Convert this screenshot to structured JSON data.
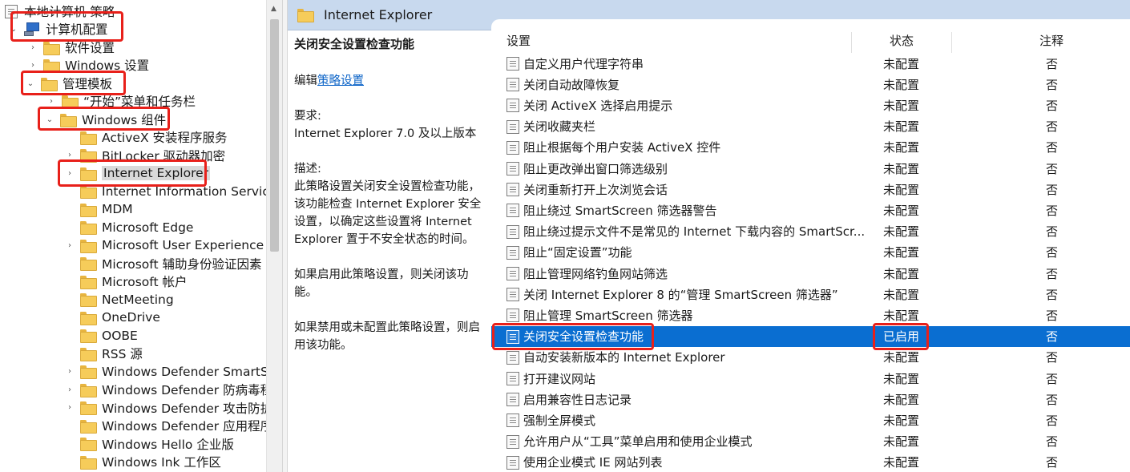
{
  "tree": {
    "root_label": "本地计算机 策略",
    "computer_config": "计算机配置",
    "software_settings": "软件设置",
    "windows_settings": "Windows 设置",
    "admin_templates": "管理模板",
    "start_menu": "“开始”菜单和任务栏",
    "windows_components": "Windows 组件",
    "components": [
      {
        "label": "ActiveX 安装程序服务",
        "expandable": false
      },
      {
        "label": "BitLocker 驱动器加密",
        "expandable": true
      },
      {
        "label": "Internet Explorer",
        "expandable": true,
        "selected": true
      },
      {
        "label": "Internet Information Services",
        "expandable": false
      },
      {
        "label": "MDM",
        "expandable": false
      },
      {
        "label": "Microsoft Edge",
        "expandable": false
      },
      {
        "label": "Microsoft User Experience Virt",
        "expandable": true
      },
      {
        "label": "Microsoft 辅助身份验证因素",
        "expandable": false
      },
      {
        "label": "Microsoft 帐户",
        "expandable": false
      },
      {
        "label": "NetMeeting",
        "expandable": false
      },
      {
        "label": "OneDrive",
        "expandable": false
      },
      {
        "label": "OOBE",
        "expandable": false
      },
      {
        "label": "RSS 源",
        "expandable": false
      },
      {
        "label": "Windows Defender SmartScre",
        "expandable": true
      },
      {
        "label": "Windows Defender 防病毒程序",
        "expandable": true
      },
      {
        "label": "Windows Defender 攻击防护",
        "expandable": true
      },
      {
        "label": "Windows Defender 应用程序防",
        "expandable": false
      },
      {
        "label": "Windows Hello 企业版",
        "expandable": false
      },
      {
        "label": "Windows Ink 工作区",
        "expandable": false
      }
    ]
  },
  "header": {
    "title": "Internet Explorer"
  },
  "description": {
    "title": "关闭安全设置检查功能",
    "edit_prefix": "编辑",
    "edit_link": "策略设置",
    "requirements_label": "要求:",
    "requirements": "Internet Explorer 7.0 及以上版本",
    "desc_label": "描述:",
    "desc_text": "此策略设置关闭安全设置检查功能，该功能检查 Internet Explorer 安全设置，以确定这些设置将 Internet Explorer 置于不安全状态的时间。",
    "enabled_text": "如果启用此策略设置，则关闭该功能。",
    "disabled_text": "如果禁用或未配置此策略设置，则启用该功能。"
  },
  "list": {
    "columns": {
      "setting": "设置",
      "state": "状态",
      "comment": "注释"
    },
    "rows": [
      {
        "name": "自定义用户代理字符串",
        "state": "未配置",
        "comment": "否"
      },
      {
        "name": "关闭自动故障恢复",
        "state": "未配置",
        "comment": "否"
      },
      {
        "name": "关闭 ActiveX 选择启用提示",
        "state": "未配置",
        "comment": "否"
      },
      {
        "name": "关闭收藏夹栏",
        "state": "未配置",
        "comment": "否"
      },
      {
        "name": "阻止根据每个用户安装 ActiveX 控件",
        "state": "未配置",
        "comment": "否"
      },
      {
        "name": "阻止更改弹出窗口筛选级别",
        "state": "未配置",
        "comment": "否"
      },
      {
        "name": "关闭重新打开上次浏览会话",
        "state": "未配置",
        "comment": "否"
      },
      {
        "name": "阻止绕过 SmartScreen 筛选器警告",
        "state": "未配置",
        "comment": "否"
      },
      {
        "name": "阻止绕过提示文件不是常见的 Internet 下载内容的 SmartScr...",
        "state": "未配置",
        "comment": "否"
      },
      {
        "name": "阻止“固定设置”功能",
        "state": "未配置",
        "comment": "否"
      },
      {
        "name": "阻止管理网络钓鱼网站筛选",
        "state": "未配置",
        "comment": "否"
      },
      {
        "name": "关闭 Internet Explorer 8 的“管理 SmartScreen 筛选器”",
        "state": "未配置",
        "comment": "否"
      },
      {
        "name": "阻止管理 SmartScreen 筛选器",
        "state": "未配置",
        "comment": "否"
      },
      {
        "name": "关闭安全设置检查功能",
        "state": "已启用",
        "comment": "否",
        "selected": true
      },
      {
        "name": "自动安装新版本的 Internet Explorer",
        "state": "未配置",
        "comment": "否"
      },
      {
        "name": "打开建议网站",
        "state": "未配置",
        "comment": "否"
      },
      {
        "name": "启用兼容性日志记录",
        "state": "未配置",
        "comment": "否"
      },
      {
        "name": "强制全屏模式",
        "state": "未配置",
        "comment": "否"
      },
      {
        "name": "允许用户从“工具”菜单启用和使用企业模式",
        "state": "未配置",
        "comment": "否"
      },
      {
        "name": "使用企业模式 IE 网站列表",
        "state": "未配置",
        "comment": "否"
      }
    ]
  },
  "colors": {
    "selection": "#0a6ed1",
    "header_bg": "#c8d9ee",
    "highlight": "#e8201a"
  }
}
